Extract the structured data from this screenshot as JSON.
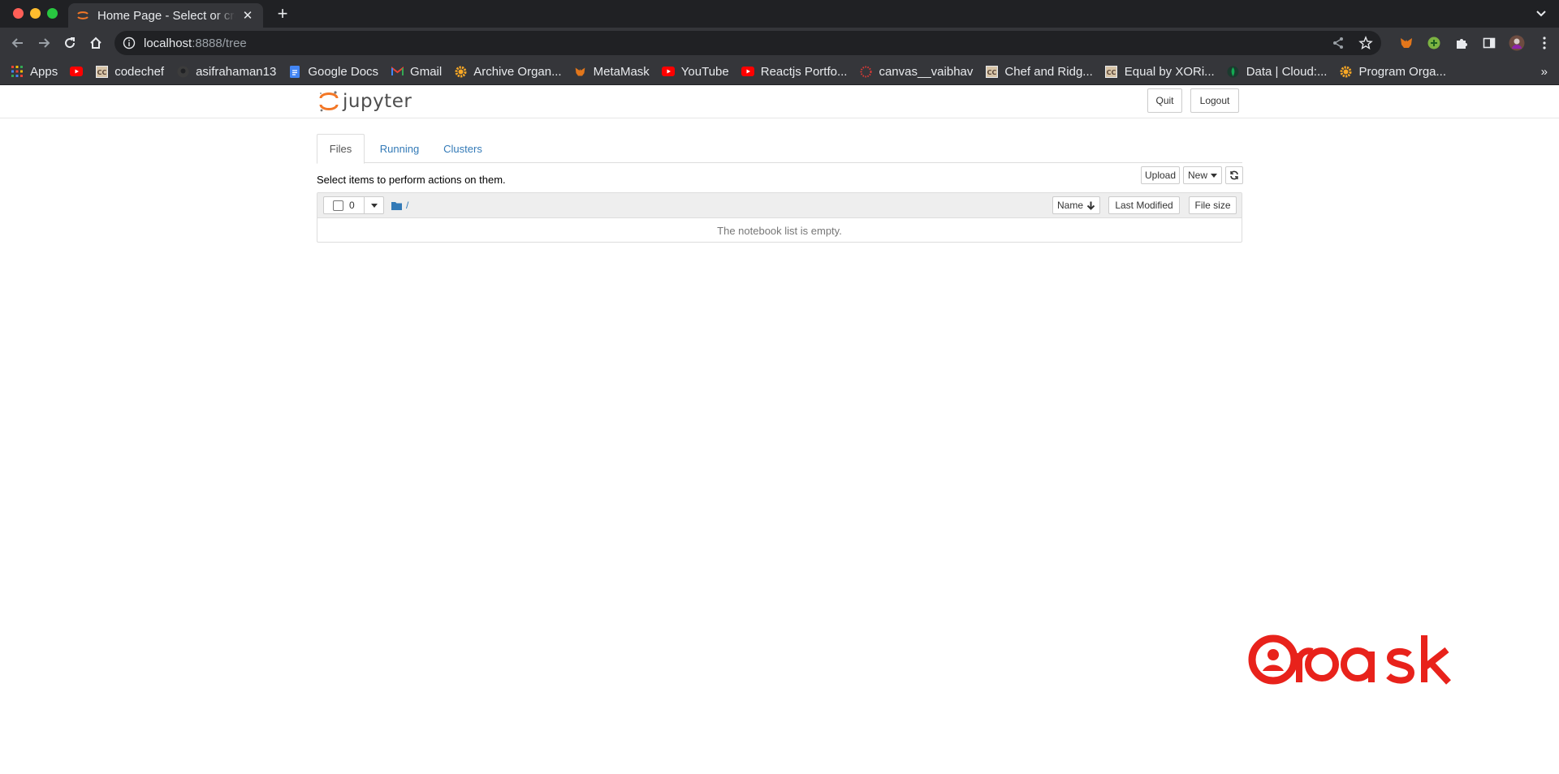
{
  "browser": {
    "tab_title": "Home Page - Select or create a notebook",
    "url_host": "localhost",
    "url_path": ":8888/tree",
    "bookmarks": [
      {
        "label": "Apps",
        "icon": "apps-grid-icon"
      },
      {
        "label": "",
        "icon": "youtube-icon"
      },
      {
        "label": "codechef",
        "icon": "codechef-icon"
      },
      {
        "label": "asifrahaman13",
        "icon": "github-icon"
      },
      {
        "label": "Google Docs",
        "icon": "google-docs-icon"
      },
      {
        "label": "Gmail",
        "icon": "gmail-icon"
      },
      {
        "label": "Archive Organ...",
        "icon": "gear-icon"
      },
      {
        "label": "MetaMask",
        "icon": "metamask-icon"
      },
      {
        "label": "YouTube",
        "icon": "youtube-icon"
      },
      {
        "label": "Reactjs Portfo...",
        "icon": "youtube-icon"
      },
      {
        "label": "canvas__vaibhav",
        "icon": "canvas-icon"
      },
      {
        "label": "Chef and Ridg...",
        "icon": "codechef-icon"
      },
      {
        "label": "Equal by XORi...",
        "icon": "codechef-icon"
      },
      {
        "label": "Data | Cloud:...",
        "icon": "mongodb-icon"
      },
      {
        "label": "Program Orga...",
        "icon": "gear-icon"
      }
    ],
    "bookmarks_more": "»"
  },
  "jupyter": {
    "logo_text": "jupyter",
    "quit_label": "Quit",
    "logout_label": "Logout",
    "tabs": [
      {
        "label": "Files"
      },
      {
        "label": "Running"
      },
      {
        "label": "Clusters"
      }
    ],
    "hint": "Select items to perform actions on them.",
    "upload_label": "Upload",
    "new_label": "New",
    "selected_count": "0",
    "breadcrumb": "/",
    "sort_name_label": "Name",
    "sort_modified_label": "Last Modified",
    "sort_size_label": "File size",
    "empty_message": "The notebook list is empty."
  },
  "colors": {
    "chrome_dark": "#202124",
    "chrome_toolbar": "#35363a",
    "jupyter_orange": "#f37726",
    "link_blue": "#337ab7",
    "watermark_red": "#e8221b"
  }
}
